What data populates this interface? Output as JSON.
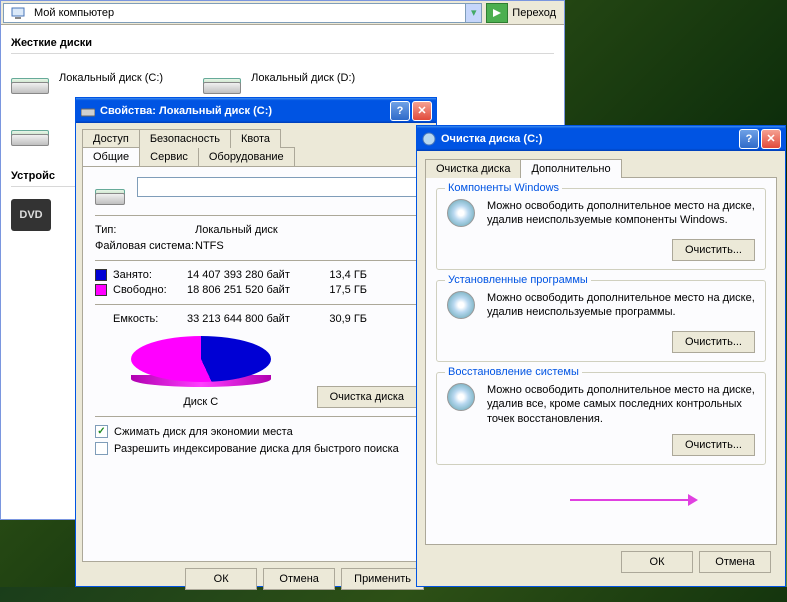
{
  "explorer": {
    "address": "Мой компьютер",
    "go_label": "Переход",
    "section_hdd": "Жесткие диски",
    "section_removable": "Устройс",
    "drives": [
      {
        "label": "Локальный диск (C:)"
      },
      {
        "label": "Локальный диск (D:)"
      }
    ],
    "dvd_label": "DVD"
  },
  "props": {
    "title": "Свойства: Локальный диск (C:)",
    "tabs_row1": [
      "Доступ",
      "Безопасность",
      "Квота"
    ],
    "tabs_row2": [
      "Общие",
      "Сервис",
      "Оборудование"
    ],
    "type_label": "Тип:",
    "type_value": "Локальный диск",
    "fs_label": "Файловая система:",
    "fs_value": "NTFS",
    "used_label": "Занято:",
    "used_bytes": "14 407 393 280 байт",
    "used_gb": "13,4 ГБ",
    "free_label": "Свободно:",
    "free_bytes": "18 806 251 520 байт",
    "free_gb": "17,5 ГБ",
    "capacity_label": "Емкость:",
    "capacity_bytes": "33 213 644 800 байт",
    "capacity_gb": "30,9 ГБ",
    "pie_label": "Диск C",
    "cleanup_btn": "Очистка диска",
    "compress_label": "Сжимать диск для экономии места",
    "index_label": "Разрешить индексирование диска для быстрого поиска",
    "ok": "ОК",
    "cancel": "Отмена",
    "apply": "Применить"
  },
  "cleanup": {
    "title": "Очистка диска  (C:)",
    "tab1": "Очистка диска",
    "tab2": "Дополнительно",
    "group1": {
      "legend": "Компоненты Windows",
      "text": "Можно освободить дополнительное место на диске, удалив неиспользуемые компоненты Windows.",
      "btn": "Очистить..."
    },
    "group2": {
      "legend": "Установленные программы",
      "text": "Можно освободить дополнительное место на диске, удалив неиспользуемые программы.",
      "btn": "Очистить..."
    },
    "group3": {
      "legend": "Восстановление системы",
      "text": "Можно освободить дополнительное место на диске, удалив все, кроме самых последних контрольных точек восстановления.",
      "btn": "Очистить..."
    },
    "ok": "ОК",
    "cancel": "Отмена"
  },
  "chart_data": {
    "type": "pie",
    "title": "Диск C",
    "series": [
      {
        "name": "Занято",
        "value": 14407393280,
        "gb": 13.4,
        "color": "#0000d4"
      },
      {
        "name": "Свободно",
        "value": 18806251520,
        "gb": 17.5,
        "color": "#ff00ff"
      }
    ],
    "total": {
      "bytes": 33213644800,
      "gb": 30.9
    }
  }
}
